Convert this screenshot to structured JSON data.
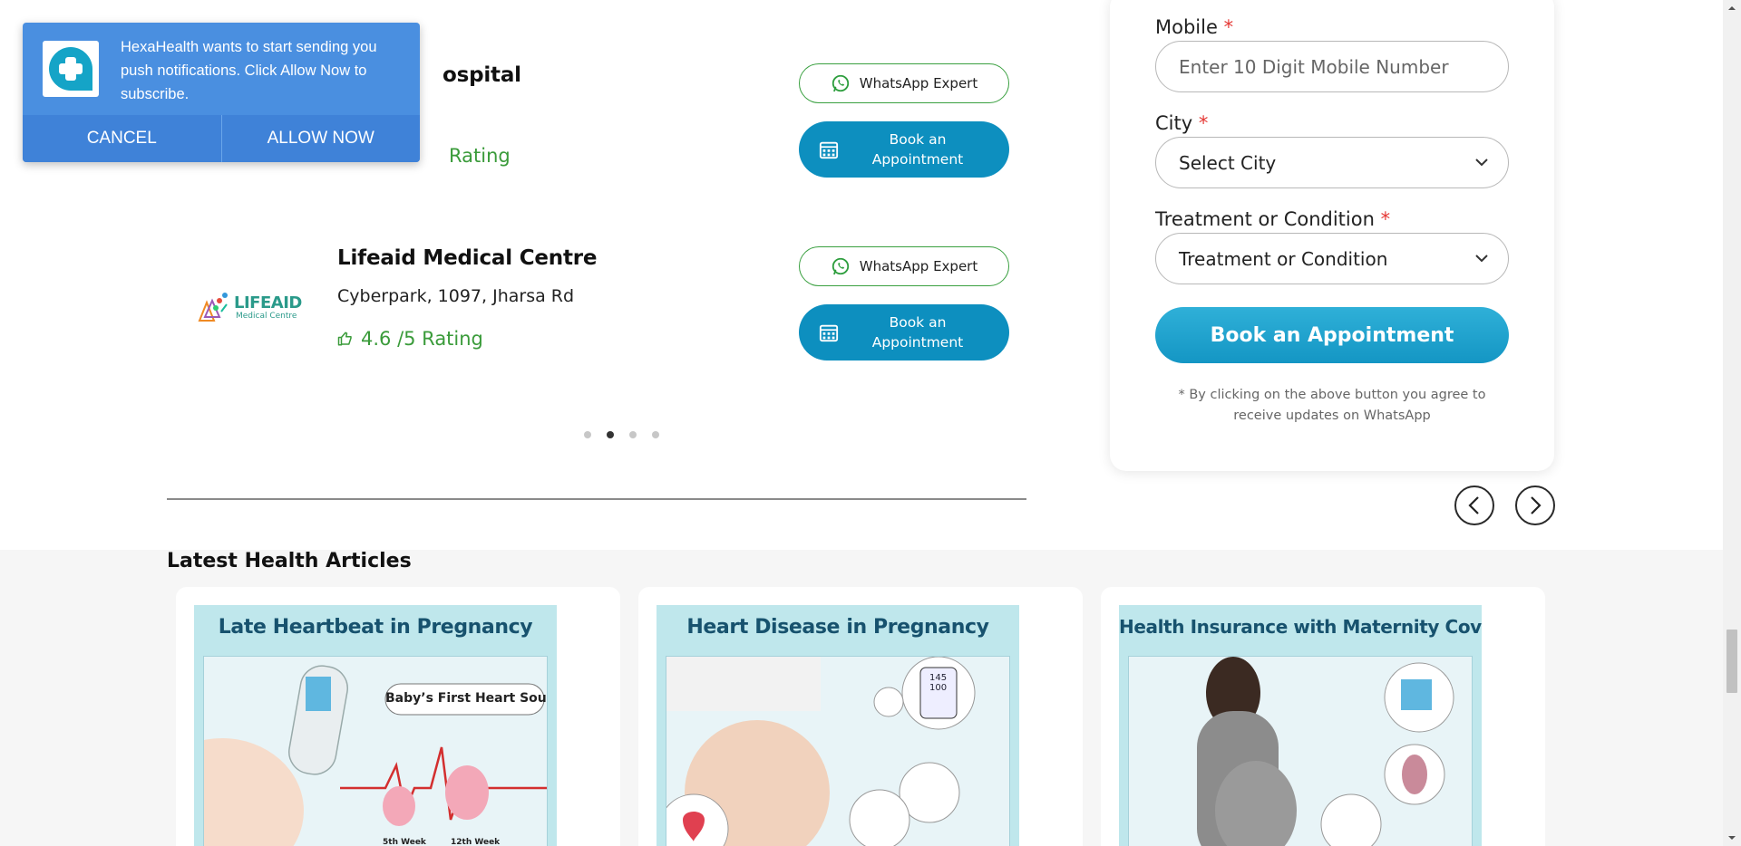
{
  "notification": {
    "message": "HexaHealth wants to start sending you push notifications. Click Allow Now to subscribe.",
    "cancel_label": "CANCEL",
    "allow_label": "ALLOW NOW"
  },
  "hospitals": [
    {
      "name_partial": "ospital",
      "rating_partial": "Rating",
      "whatsapp_label": "WhatsApp Expert",
      "book_label": "Book an Appointment"
    },
    {
      "name": "Lifeaid Medical Centre",
      "address": "Cyberpark, 1097, Jharsa Rd",
      "rating": "4.6 /5 Rating",
      "logo_text": "LIFEAID",
      "logo_subtext": "Medical Centre",
      "whatsapp_label": "WhatsApp Expert",
      "book_label": "Book an Appointment"
    }
  ],
  "carousel": {
    "dot_count": 4,
    "active_index": 1
  },
  "form": {
    "mobile_label": "Mobile",
    "mobile_placeholder": "Enter 10 Digit Mobile Number",
    "city_label": "City",
    "city_value": "Select City",
    "treatment_label": "Treatment or Condition",
    "treatment_value": "Treatment or Condition",
    "required_mark": "*",
    "submit_label": "Book an Appointment",
    "consent": "* By clicking on the above button you agree to receive updates on WhatsApp"
  },
  "articles": {
    "title": "Latest Health Articles",
    "items": [
      {
        "image_title": "Late Heartbeat in Pregnancy",
        "callout": "Baby’s First Heart Sound",
        "week_a": "5th Week",
        "week_b": "12th Week"
      },
      {
        "image_title": "Heart Disease in Pregnancy",
        "monitor_top": "145",
        "monitor_bottom": "100"
      },
      {
        "image_title": "Health Insurance with Maternity Cover"
      }
    ]
  },
  "colors": {
    "brand_blue": "#0d8fbf",
    "notification_blue": "#4a8fe0",
    "rating_green": "#3a9b3a",
    "required_red": "#e53935"
  }
}
